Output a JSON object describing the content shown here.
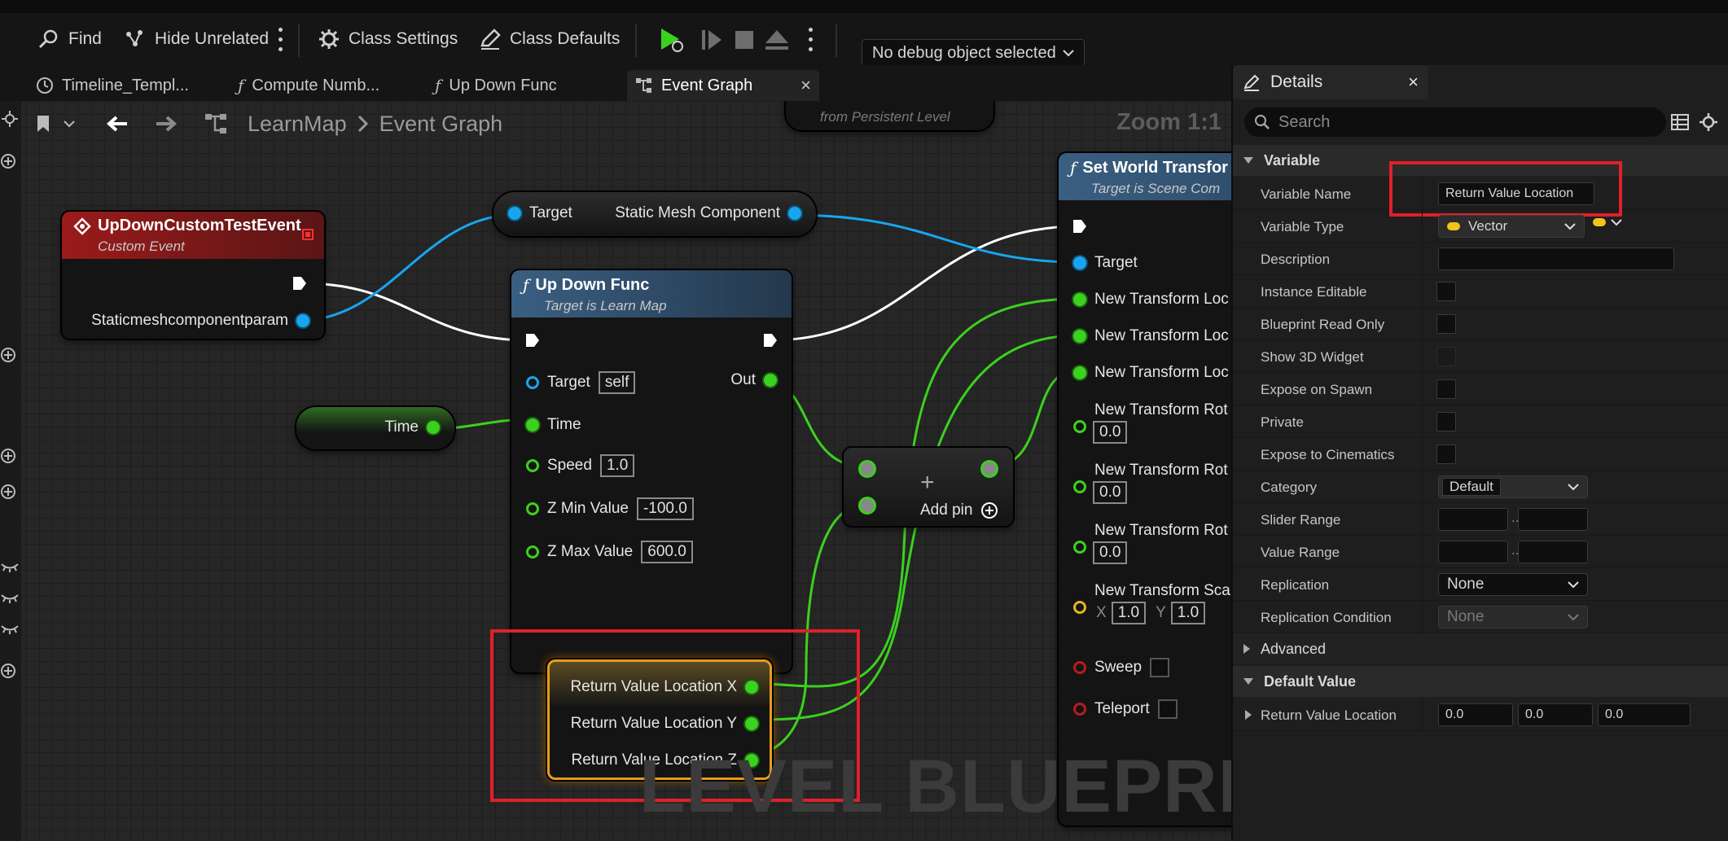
{
  "toolbar": {
    "find": "Find",
    "hide_unrelated": "Hide Unrelated",
    "class_settings": "Class Settings",
    "class_defaults": "Class Defaults",
    "debug_object": "No debug object selected"
  },
  "tabs": [
    {
      "label": "Timeline_Templ..."
    },
    {
      "label": "Compute Numb..."
    },
    {
      "label": "Up Down Func"
    },
    {
      "label": "Event Graph"
    }
  ],
  "breadcrumb": {
    "root": "LearnMap",
    "current": "Event Graph"
  },
  "zoom": "Zoom 1:1",
  "watermark": "LEVEL BLUEPRINT",
  "partial_node_text": "from Persistent Level",
  "nodes": {
    "custom_event": {
      "title": "UpDownCustomTestEvent",
      "subtitle": "Custom Event",
      "param": "Staticmeshcomponentparam"
    },
    "target_getter": {
      "left": "Target",
      "right": "Static Mesh Component"
    },
    "up_down_func": {
      "title": "Up Down Func",
      "subtitle": "Target is Learn Map",
      "target": "Target",
      "target_val": "self",
      "out": "Out",
      "time": "Time",
      "speed": "Speed",
      "speed_val": "1.0",
      "zmin": "Z Min Value",
      "zmin_val": "-100.0",
      "zmax": "Z Max Value",
      "zmax_val": "600.0"
    },
    "time_getter": {
      "label": "Time"
    },
    "add_node": {
      "add_pin": "Add pin"
    },
    "return_value": {
      "x": "Return Value Location X",
      "y": "Return Value Location Y",
      "z": "Return Value Location Z"
    },
    "set_world_transform": {
      "title": "Set World Transfor",
      "subtitle": "Target is Scene Com",
      "target": "Target",
      "loc1": "New Transform Loc",
      "loc2": "New Transform Loc",
      "loc3": "New Transform Loc",
      "rot1": "New Transform Rot",
      "rot1_val": "0.0",
      "rot2": "New Transform Rot",
      "rot2_val": "0.0",
      "rot3": "New Transform Rot",
      "rot3_val": "0.0",
      "scale": "New Transform Sca",
      "scale_x_label": "X",
      "scale_x": "1.0",
      "scale_y_label": "Y",
      "scale_y": "1.0",
      "sweep": "Sweep",
      "teleport": "Teleport"
    }
  },
  "details": {
    "title": "Details",
    "search_placeholder": "Search",
    "sections": {
      "variable": "Variable",
      "advanced": "Advanced",
      "default_value": "Default Value"
    },
    "rows": {
      "variable_name": {
        "label": "Variable Name",
        "value": "Return Value Location"
      },
      "variable_type": {
        "label": "Variable Type",
        "value": "Vector"
      },
      "description": {
        "label": "Description"
      },
      "instance_editable": {
        "label": "Instance Editable"
      },
      "blueprint_read_only": {
        "label": "Blueprint Read Only"
      },
      "show_3d_widget": {
        "label": "Show 3D Widget"
      },
      "expose_on_spawn": {
        "label": "Expose on Spawn"
      },
      "private": {
        "label": "Private"
      },
      "expose_to_cinematics": {
        "label": "Expose to Cinematics"
      },
      "category": {
        "label": "Category",
        "value": "Default"
      },
      "slider_range": {
        "label": "Slider Range"
      },
      "value_range": {
        "label": "Value Range"
      },
      "replication": {
        "label": "Replication",
        "value": "None"
      },
      "replication_condition": {
        "label": "Replication Condition",
        "value": "None"
      },
      "return_value_location": {
        "label": "Return Value Location",
        "x": "0.0",
        "y": "0.0",
        "z": "0.0"
      }
    }
  },
  "colors": {
    "exec_wire": "#ffffff",
    "float_wire": "#3bd11f",
    "object_wire": "#18a5f0",
    "highlight": "#e0202a",
    "event_header": "#9b1b1b",
    "function_header": "#3a5f82"
  }
}
